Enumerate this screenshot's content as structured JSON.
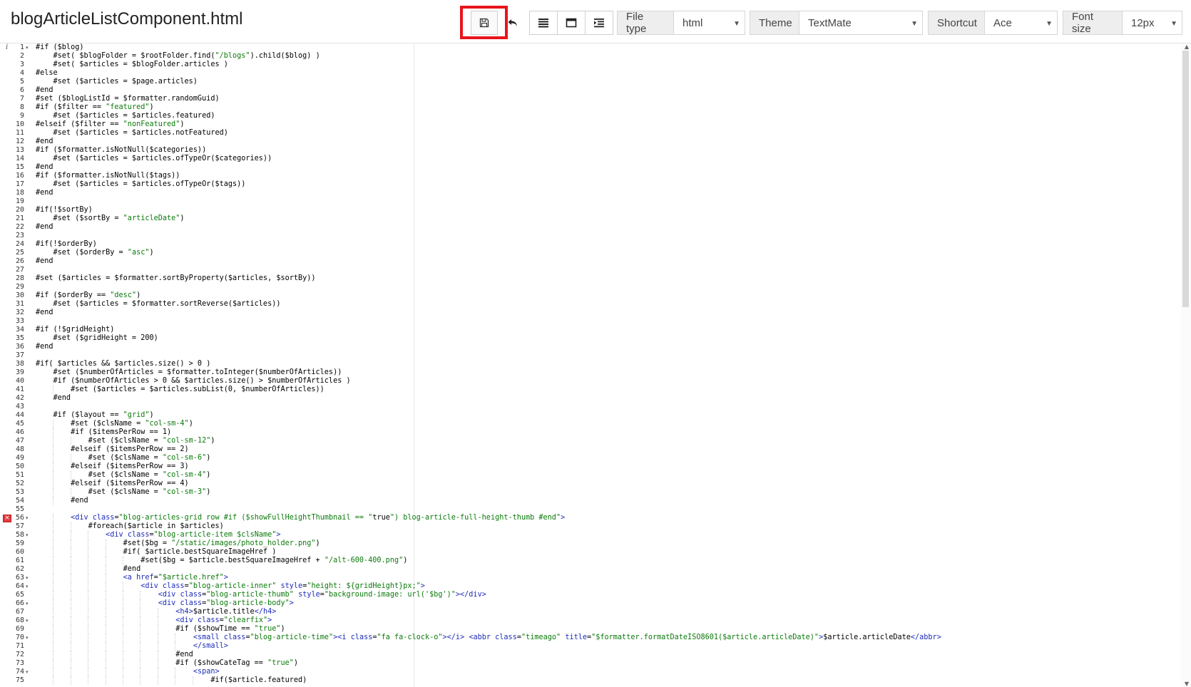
{
  "header": {
    "file_title": "blogArticleListComponent.html"
  },
  "toolbar": {
    "groups": [
      {
        "label": "File type",
        "value": "html"
      },
      {
        "label": "Theme",
        "value": "TextMate"
      },
      {
        "label": "Shortcut",
        "value": "Ace"
      },
      {
        "label": "Font size",
        "value": "12px"
      }
    ]
  },
  "editor": {
    "first_line": 1,
    "folded_lines": [
      1,
      56,
      58,
      63,
      64,
      66,
      68,
      70,
      74
    ],
    "error_line": 56,
    "info_line": 1,
    "info_glyph": "i",
    "error_glyph": "×",
    "fold_glyph": "▾",
    "lines": [
      "#if ($blog)",
      "    #set( $blogFolder = $rootFolder.find(\"/blogs\").child($blog) )",
      "    #set( $articles = $blogFolder.articles )",
      "#else",
      "    #set ($articles = $page.articles)",
      "#end",
      "#set ($blogListId = $formatter.randomGuid)",
      "#if ($filter == \"featured\")",
      "    #set ($articles = $articles.featured)",
      "#elseif ($filter == \"nonFeatured\")",
      "    #set ($articles = $articles.notFeatured)",
      "#end",
      "#if ($formatter.isNotNull($categories))",
      "    #set ($articles = $articles.ofTypeOr($categories))",
      "#end",
      "#if ($formatter.isNotNull($tags))",
      "    #set ($articles = $articles.ofTypeOr($tags))",
      "#end",
      "",
      "#if(!$sortBy)",
      "    #set ($sortBy = \"articleDate\")",
      "#end",
      "",
      "#if(!$orderBy)",
      "    #set ($orderBy = \"asc\")",
      "#end",
      "",
      "#set ($articles = $formatter.sortByProperty($articles, $sortBy))",
      "",
      "#if ($orderBy == \"desc\")",
      "    #set ($articles = $formatter.sortReverse($articles))",
      "#end",
      "",
      "#if (!$gridHeight)",
      "    #set ($gridHeight = 200)",
      "#end",
      "",
      "#if( $articles && $articles.size() > 0 )",
      "    #set ($numberOfArticles = $formatter.toInteger($numberOfArticles))",
      "    #if ($numberOfArticles > 0 && $articles.size() > $numberOfArticles )",
      "        #set ($articles = $articles.subList(0, $numberOfArticles))",
      "    #end",
      "",
      "    #if ($layout == \"grid\")",
      "        #set ($clsName = \"col-sm-4\")",
      "        #if ($itemsPerRow == 1)",
      "            #set ($clsName = \"col-sm-12\")",
      "        #elseif ($itemsPerRow == 2)",
      "            #set ($clsName = \"col-sm-6\")",
      "        #elseif ($itemsPerRow == 3)",
      "            #set ($clsName = \"col-sm-4\")",
      "        #elseif ($itemsPerRow == 4)",
      "            #set ($clsName = \"col-sm-3\")",
      "        #end",
      "",
      "        <div class=\"blog-articles-grid row #if ($showFullHeightThumbnail == \"true\") blog-article-full-height-thumb #end\">",
      "            #foreach($article in $articles)",
      "                <div class=\"blog-article-item $clsName\">",
      "                    #set($bg = \"/static/images/photo_holder.png\")",
      "                    #if( $article.bestSquareImageHref )",
      "                        #set($bg = $article.bestSquareImageHref + \"/alt-600-400.png\")",
      "                    #end",
      "                    <a href=\"$article.href\">",
      "                        <div class=\"blog-article-inner\" style=\"height: ${gridHeight}px;\">",
      "                            <div class=\"blog-article-thumb\" style=\"background-image: url('$bg')\"></div>",
      "                            <div class=\"blog-article-body\">",
      "                                <h4>$article.title</h4>",
      "                                <div class=\"clearfix\">",
      "                                #if ($showTime == \"true\")",
      "                                    <small class=\"blog-article-time\"><i class=\"fa fa-clock-o\"></i> <abbr class=\"timeago\" title=\"$formatter.formatDateISO8601($article.articleDate)\">$article.articleDate</abbr>",
      "                                    </small>",
      "                                #end",
      "                                #if ($showCateTag == \"true\")",
      "                                    <span>",
      "                                        #if($article.featured)"
    ]
  }
}
